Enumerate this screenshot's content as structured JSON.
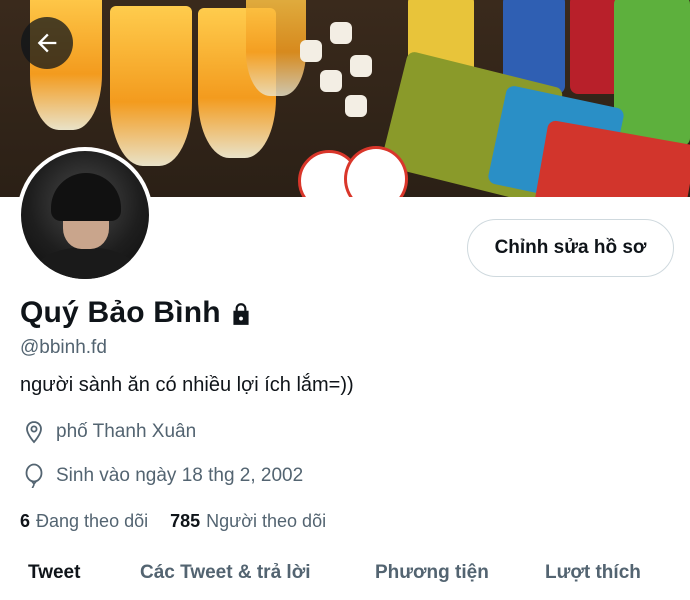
{
  "profile": {
    "name": "Quý Bảo Bình",
    "handle": "@bbinh.fd",
    "bio": "người sành ăn có nhiều lợi ích lắm=))",
    "location": "phố Thanh Xuân",
    "birthday": "Sinh vào ngày 18 thg 2, 2002",
    "protected_icon": "lock-icon"
  },
  "actions": {
    "edit_profile_label": "Chỉnh sửa hồ sơ",
    "back_icon": "arrow-left-icon"
  },
  "stats": {
    "following_count": "6",
    "following_label": "Đang theo dõi",
    "followers_count": "785",
    "followers_label": "Người theo dõi"
  },
  "tabs": [
    {
      "label": "Tweet",
      "active": true
    },
    {
      "label": "Các Tweet & trả lời",
      "active": false
    },
    {
      "label": "Phương tiện",
      "active": false
    },
    {
      "label": "Lượt thích",
      "active": false
    }
  ],
  "colors": {
    "text_primary": "#0f1419",
    "text_secondary": "#536471",
    "border": "#cfd9de"
  }
}
